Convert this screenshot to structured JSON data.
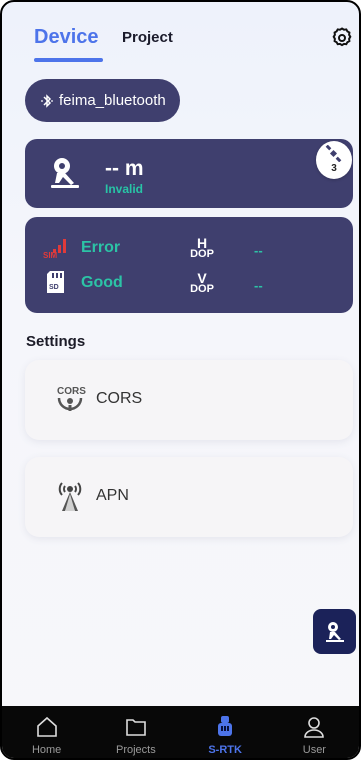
{
  "header": {
    "tab_device": "Device",
    "tab_project": "Project",
    "settings_icon": "gear-icon"
  },
  "bluetooth": {
    "icon": "bluetooth-icon",
    "name": "feima_bluetooth"
  },
  "position_card": {
    "value": "-- m",
    "status": "Invalid",
    "satellite_count": "3"
  },
  "status_card": {
    "sim_status": "Error",
    "sd_status": "Good",
    "hdop_top": "H",
    "hdop_bottom": "DOP",
    "hdop_value": "--",
    "vdop_top": "V",
    "vdop_bottom": "DOP",
    "vdop_value": "--"
  },
  "settings": {
    "title": "Settings",
    "items": [
      {
        "label": "CORS",
        "icon": "cors-icon"
      },
      {
        "label": "APN",
        "icon": "apn-tower-icon"
      }
    ]
  },
  "bottom_nav": {
    "items": [
      {
        "label": "Home",
        "icon": "home-icon"
      },
      {
        "label": "Projects",
        "icon": "folder-icon"
      },
      {
        "label": "S-RTK",
        "icon": "receiver-icon",
        "active": true
      },
      {
        "label": "User",
        "icon": "user-icon"
      }
    ]
  },
  "colors": {
    "accent": "#4d74ea",
    "card": "#3f3f6e",
    "status_good": "#2cc3a6",
    "status_error": "#e03a3a",
    "nav_bg": "#080808"
  }
}
